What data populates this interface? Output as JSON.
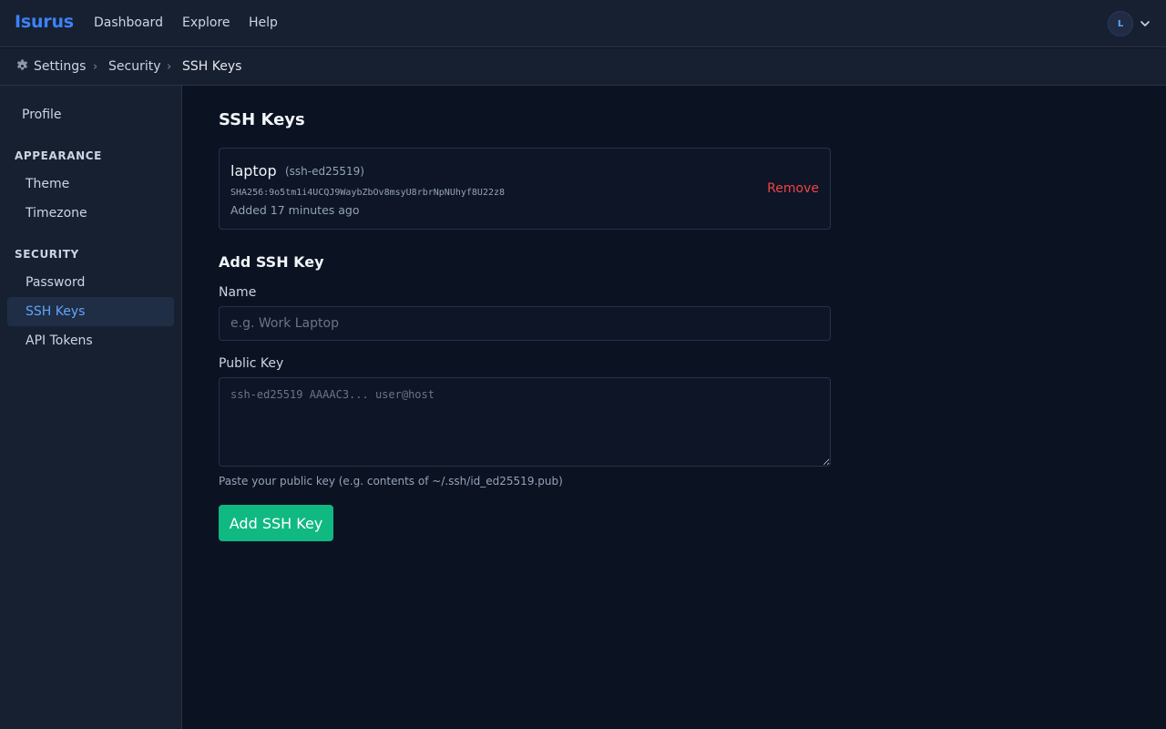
{
  "app": {
    "logo": "Isurus",
    "nav": [
      "Dashboard",
      "Explore",
      "Help"
    ],
    "avatar_initial": "L",
    "accent_color": "#3b82f6"
  },
  "breadcrumb": {
    "icon": "gear-icon",
    "items": [
      "Settings",
      "Security",
      "SSH Keys"
    ],
    "separator": "›"
  },
  "sidebar": {
    "top_item": "Profile",
    "sections": [
      {
        "title": "APPEARANCE",
        "items": [
          "Theme",
          "Timezone"
        ]
      },
      {
        "title": "SECURITY",
        "items": [
          "Password",
          "SSH Keys",
          "API Tokens"
        ]
      }
    ],
    "active_item": "SSH Keys"
  },
  "main": {
    "title": "SSH Keys",
    "keys": [
      {
        "name": "laptop",
        "type": "(ssh-ed25519)",
        "fingerprint": "SHA256:9o5tm1i4UCQJ9WaybZbOv8msyU8rbrNpNUhyf8U22z8",
        "added": "Added 17 minutes ago",
        "remove_label": "Remove"
      }
    ],
    "add_section": {
      "title": "Add SSH Key",
      "name_label": "Name",
      "name_placeholder": "e.g. Work Laptop",
      "name_value": "",
      "key_label": "Public Key",
      "key_placeholder": "ssh-ed25519 AAAAC3... user@host",
      "key_value": "",
      "hint": "Paste your public key (e.g. contents of ~/.ssh/id_ed25519.pub)",
      "submit_label": "Add SSH Key"
    }
  },
  "colors": {
    "danger": "#ef4444",
    "success": "#10b981",
    "background": "#0b1222",
    "panel": "#172031"
  }
}
